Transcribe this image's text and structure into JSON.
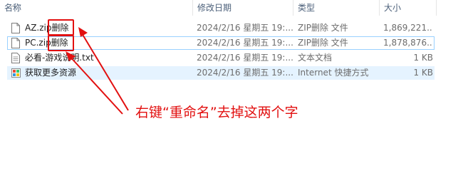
{
  "columns": {
    "name": "名称",
    "modified": "修改日期",
    "type": "类型",
    "size": "大小"
  },
  "files": [
    {
      "name": "AZ.zip删除",
      "modified": "2024/2/16 星期五 19:...",
      "type": "ZIP删除 文件",
      "size": "1,869,221...",
      "icon": "zip-file-icon"
    },
    {
      "name": "PC.zip删除",
      "modified": "2024/2/16 星期五 19:...",
      "type": "ZIP删除 文件",
      "size": "1,878,876...",
      "icon": "zip-file-icon"
    },
    {
      "name": "必看-游戏说明.txt",
      "modified": "2024/2/16 星期五 19:...",
      "type": "文本文档",
      "size": "1 KB",
      "icon": "text-file-icon"
    },
    {
      "name": "获取更多资源",
      "modified": "2024/2/16 星期五 19:...",
      "type": "Internet 快捷方式",
      "size": "1 KB",
      "icon": "internet-shortcut-icon"
    }
  ],
  "annotation": {
    "text": "右键“重命名”去掉这两个字",
    "color": "#e21010"
  },
  "colors": {
    "header_text": "#4c607a",
    "selected_row": "#e5f3ff",
    "annotation_red": "#e21010"
  }
}
